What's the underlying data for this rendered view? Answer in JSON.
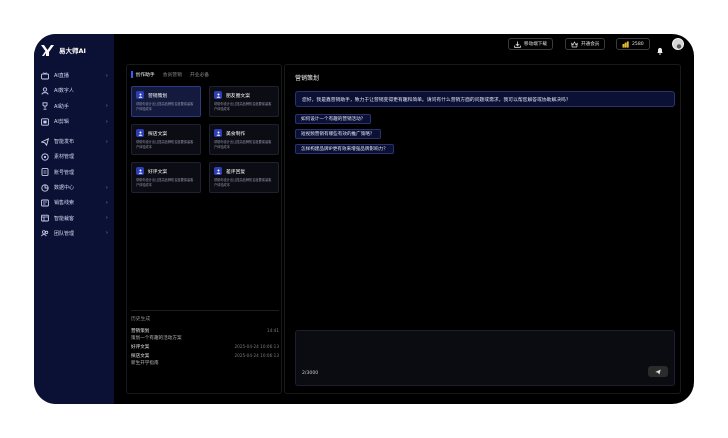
{
  "brand": {
    "name": "易大师AI"
  },
  "sidebar": {
    "items": [
      {
        "label": "AI直播",
        "icon": "live-icon",
        "chevron": "›"
      },
      {
        "label": "AI数字人",
        "icon": "person-icon",
        "chevron": ""
      },
      {
        "label": "AI助手",
        "icon": "trophy-icon",
        "chevron": "›"
      },
      {
        "label": "AI剪辑",
        "icon": "clip-icon",
        "chevron": "›"
      },
      {
        "label": "智能发布",
        "icon": "send-icon",
        "chevron": "›"
      },
      {
        "label": "素材管理",
        "icon": "material-icon",
        "chevron": ""
      },
      {
        "label": "账号管理",
        "icon": "account-icon",
        "chevron": ""
      },
      {
        "label": "数据中心",
        "icon": "data-icon",
        "chevron": "›"
      },
      {
        "label": "销售线索",
        "icon": "leads-icon",
        "chevron": "›"
      },
      {
        "label": "智能裁客",
        "icon": "customer-icon",
        "chevron": "›"
      },
      {
        "label": "团队管理",
        "icon": "team-icon",
        "chevron": "›"
      }
    ]
  },
  "topbar": {
    "download_label": "移动端下载",
    "vip_label": "开通会员",
    "coins": "2580"
  },
  "left_panel": {
    "tabs": [
      "创作助手",
      "会员营销",
      "开业必备"
    ],
    "active_tab": 0,
    "cards": [
      {
        "title": "营销策划",
        "desc": "帮助你设计出让提高品牌知名度要保留客户体验成本",
        "selected": true
      },
      {
        "title": "朋友圈文案",
        "desc": "帮助你设计出让提高品牌知名度要保留客户体验成本",
        "selected": false
      },
      {
        "title": "探店文案",
        "desc": "帮助你设计出让提高品牌知名度要保留客户体验成本",
        "selected": false
      },
      {
        "title": "美食制作",
        "desc": "帮助你设计出让提高品牌知名度要保留客户体验成本",
        "selected": false
      },
      {
        "title": "好评文案",
        "desc": "帮助你设计出让提高品牌知名度要保留客户体验成本",
        "selected": false
      },
      {
        "title": "差评回复",
        "desc": "帮助你设计出让提高品牌知名度要保留客户体验成本",
        "selected": false
      }
    ],
    "history_heading": "历史生成",
    "history": [
      {
        "name": "营销策划",
        "time": "14:41",
        "sub": "策划一个有趣的活动方案"
      },
      {
        "name": "好评文案",
        "time": "2025-04-24 10:06:13",
        "sub": ""
      },
      {
        "name": "探店文案",
        "time": "2025-04-24 10:06:13",
        "sub": "新生开学指南"
      }
    ]
  },
  "right_panel": {
    "title": "营销策划",
    "greeting": "您好，我是鑫营销助手，致力于让营销变得更有趣和简单。请问有什么营销方面的问题或需求，我可以帮您解答或协助解决吗？",
    "suggestions": [
      "如何设计一个有趣的营销活动？",
      "短视频营销有哪些有效的推广策略？",
      "怎样构建品牌IP更有效来增强品牌影响力？"
    ],
    "input_counter": "2/3000"
  },
  "colors": {
    "sidebar_bg": "#0b1035",
    "accent": "#2d3eb7",
    "card_selected_bg": "#141a3d",
    "chip_bg": "#0b1035",
    "coin": "#e7b932"
  }
}
